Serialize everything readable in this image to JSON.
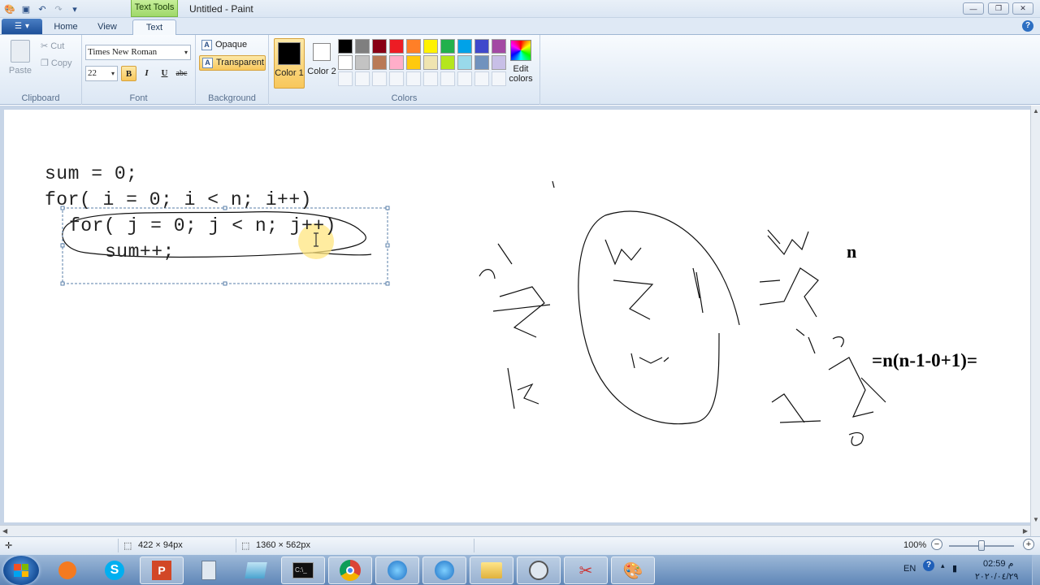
{
  "window": {
    "title": "Untitled - Paint",
    "contextual_tab": "Text Tools"
  },
  "tabs": [
    "Home",
    "View",
    "Text"
  ],
  "ribbon": {
    "clipboard": {
      "paste": "Paste",
      "cut": "Cut",
      "copy": "Copy",
      "label": "Clipboard"
    },
    "font": {
      "family": "Times New Roman",
      "size": "22",
      "bold": "B",
      "italic": "I",
      "underline": "U",
      "strike": "abc",
      "label": "Font"
    },
    "background": {
      "opaque": "Opaque",
      "transparent": "Transparent",
      "label": "Background"
    },
    "colors": {
      "color1": "Color 1",
      "color2": "Color 2",
      "edit": "Edit colors",
      "label": "Colors",
      "color1_value": "#000000",
      "color2_value": "#ffffff",
      "palette_row1": [
        "#000000",
        "#7f7f7f",
        "#880015",
        "#ed1c24",
        "#ff7f27",
        "#fff200",
        "#22b14c",
        "#00a2e8",
        "#3f48cc",
        "#a349a4"
      ],
      "palette_row2": [
        "#ffffff",
        "#c3c3c3",
        "#b97a57",
        "#ffaec9",
        "#ffc90e",
        "#efe4b0",
        "#b5e61d",
        "#99d9ea",
        "#7092be",
        "#c8bfe7"
      ]
    }
  },
  "canvas": {
    "code_lines": [
      "sum = 0;",
      "for( i = 0; i < n; i++)",
      "for( j = 0; j < n; j++)",
      "sum++;"
    ],
    "handwriting": [
      "n",
      "=n(n-1-0+1)="
    ]
  },
  "statusbar": {
    "selection_size": "422 × 94px",
    "image_size": "1360 × 562px",
    "zoom": "100%"
  },
  "taskbar": {
    "language": "EN",
    "time": "02:59 م",
    "date": "٢٠٢٠/٠٤/٢٩"
  }
}
